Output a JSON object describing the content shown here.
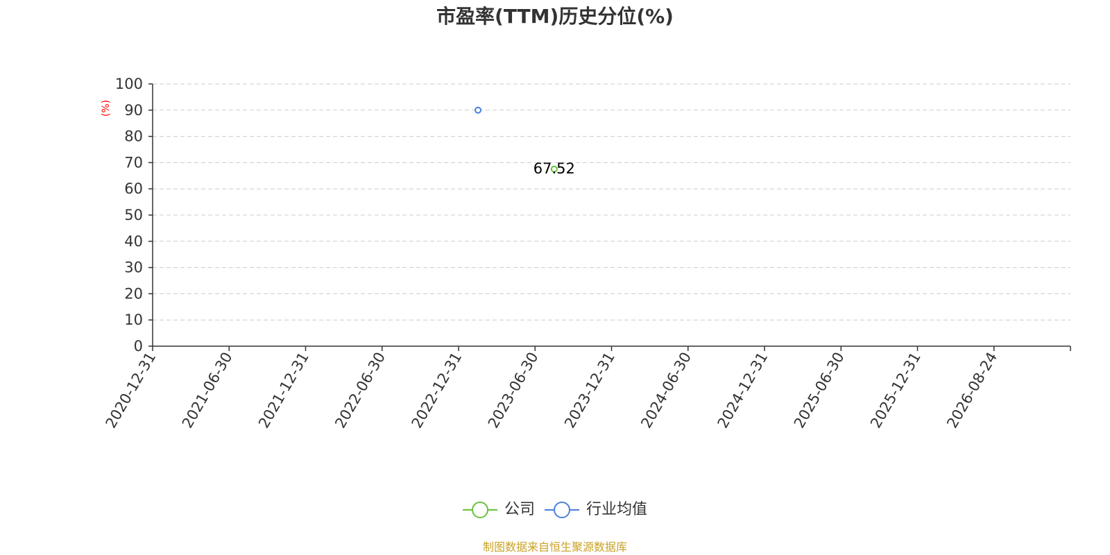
{
  "chart_data": {
    "type": "scatter",
    "title": "市盈率(TTM)历史分位(%)",
    "ylabel": "(%)",
    "ylim": [
      0,
      100
    ],
    "yticks": [
      0,
      10,
      20,
      30,
      40,
      50,
      60,
      70,
      80,
      90,
      100
    ],
    "x_categories": [
      "2020-12-31",
      "2021-06-30",
      "2021-12-31",
      "2022-06-30",
      "2022-12-31",
      "2023-06-30",
      "2023-12-31",
      "2024-06-30",
      "2024-12-31",
      "2025-06-30",
      "2025-12-31",
      "2026-08-24"
    ],
    "grid": true,
    "legend_position": "bottom-center",
    "series": [
      {
        "name": "公司",
        "color": "#67c23a",
        "points": [
          {
            "x": "2023-08",
            "y": 67.52,
            "label": "67.52"
          }
        ]
      },
      {
        "name": "行业均值",
        "color": "#4a7fdc",
        "points": [
          {
            "x": "2023-02",
            "y": 90
          }
        ]
      }
    ]
  },
  "source_note": "制图数据来自恒生聚源数据库",
  "colors": {
    "ylabel": "#ff0000",
    "source_note": "#c9a227",
    "axis": "#333333",
    "grid": "#cccccc"
  }
}
